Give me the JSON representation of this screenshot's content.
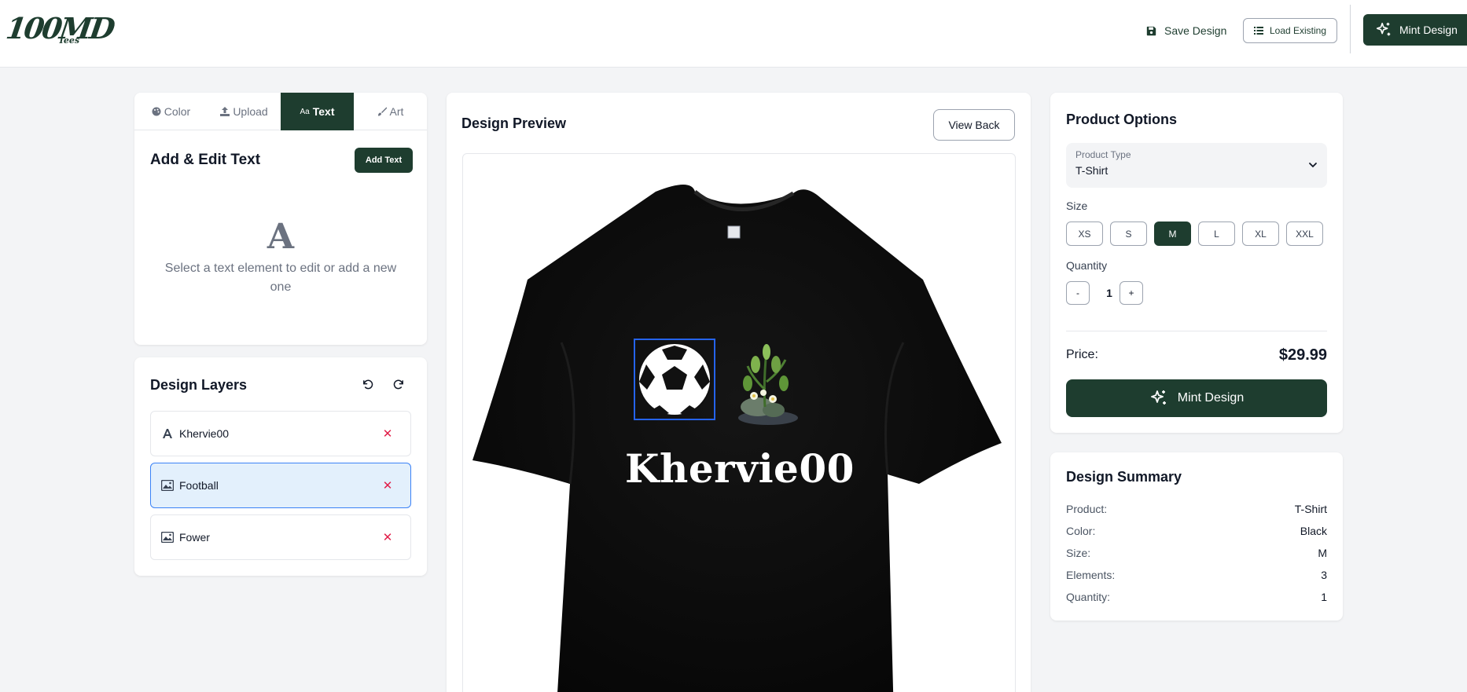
{
  "header": {
    "logo_text": "100MD",
    "logo_sub": "Tees",
    "save_label": "Save Design",
    "load_label": "Load Existing",
    "mint_label": "Mint Design"
  },
  "tabs": [
    {
      "label": "Color",
      "icon": "palette-icon"
    },
    {
      "label": "Upload",
      "icon": "upload-icon"
    },
    {
      "label": "Text",
      "icon": "text-icon",
      "badge": "Aa",
      "active": true
    },
    {
      "label": "Art",
      "icon": "paintbrush-icon"
    }
  ],
  "text_panel": {
    "title": "Add & Edit Text",
    "add_label": "Add Text",
    "glyph": "A",
    "hint": "Select a text element to edit or add a new one"
  },
  "layers_panel": {
    "title": "Design Layers",
    "undo_icon": "undo-icon",
    "redo_icon": "redo-icon",
    "layers": [
      {
        "name": "Khervie00",
        "type": "text",
        "icon": "text-a-icon",
        "selected": false
      },
      {
        "name": "Football",
        "type": "image",
        "icon": "image-icon",
        "selected": true
      },
      {
        "name": "Fower",
        "type": "image",
        "icon": "image-icon",
        "selected": false
      }
    ]
  },
  "preview": {
    "title": "Design Preview",
    "view_back_label": "View Back",
    "shirt_color": "#0b0b0b",
    "shirt_text": "Khervie00"
  },
  "options": {
    "title": "Product Options",
    "product_type_label": "Product Type",
    "product_type_value": "T-Shirt",
    "size_label": "Size",
    "sizes": [
      "XS",
      "S",
      "M",
      "L",
      "XL",
      "XXL"
    ],
    "selected_size": "M",
    "quantity_label": "Quantity",
    "quantity": "1",
    "minus": "-",
    "plus": "+",
    "price_label": "Price:",
    "price_value": "$29.99",
    "mint_label": "Mint Design"
  },
  "summary": {
    "title": "Design Summary",
    "rows": [
      {
        "key": "Product:",
        "value": "T-Shirt"
      },
      {
        "key": "Color:",
        "value": "Black"
      },
      {
        "key": "Size:",
        "value": "M"
      },
      {
        "key": "Elements:",
        "value": "3"
      },
      {
        "key": "Quantity:",
        "value": "1"
      }
    ]
  },
  "colors": {
    "brand": "#1e3d2f",
    "selection_blue": "#3b82f6",
    "delete_red": "#e11d48",
    "page_bg": "#f3f4f6"
  }
}
